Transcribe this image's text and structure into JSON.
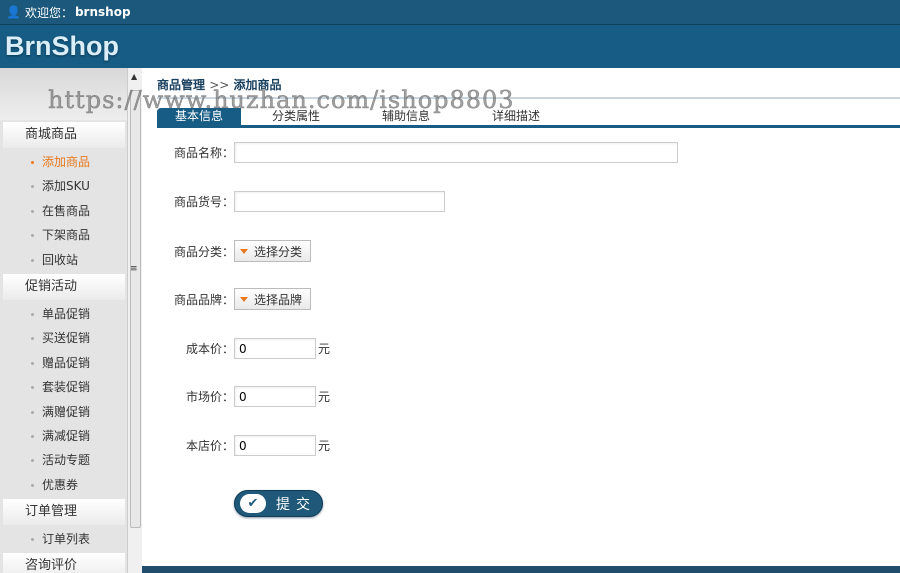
{
  "topbar": {
    "welcome": "欢迎您：",
    "user": "brnshop"
  },
  "header": {
    "logo": "BrnShop"
  },
  "sidebar": {
    "groups": [
      {
        "label": "商城商品",
        "items": [
          "添加商品",
          "添加SKU",
          "在售商品",
          "下架商品",
          "回收站"
        ]
      },
      {
        "label": "促销活动",
        "items": [
          "单品促销",
          "买送促销",
          "赠品促销",
          "套装促销",
          "满赠促销",
          "满减促销",
          "活动专题",
          "优惠券"
        ]
      },
      {
        "label": "订单管理",
        "items": [
          "订单列表"
        ]
      },
      {
        "label": "咨询评价",
        "items": []
      }
    ],
    "active_item": "添加商品"
  },
  "breadcrumb": {
    "parent": "商品管理",
    "sep": ">>",
    "current": "添加商品"
  },
  "tabs": [
    "基本信息",
    "分类属性",
    "辅助信息",
    "详细描述"
  ],
  "form": {
    "name_label": "商品名称：",
    "name_value": "",
    "sn_label": "商品货号：",
    "sn_value": "",
    "category_label": "商品分类：",
    "category_button": "选择分类",
    "brand_label": "商品品牌：",
    "brand_button": "选择品牌",
    "cost_label": "成本价：",
    "cost_value": "0",
    "market_label": "市场价：",
    "market_value": "0",
    "shop_label": "本店价：",
    "shop_value": "0",
    "unit": "元",
    "submit": "提交"
  },
  "watermark": "https://www.huzhan.com/ishop8803",
  "colors": {
    "primary": "#175c84",
    "accent": "#e8791d"
  }
}
